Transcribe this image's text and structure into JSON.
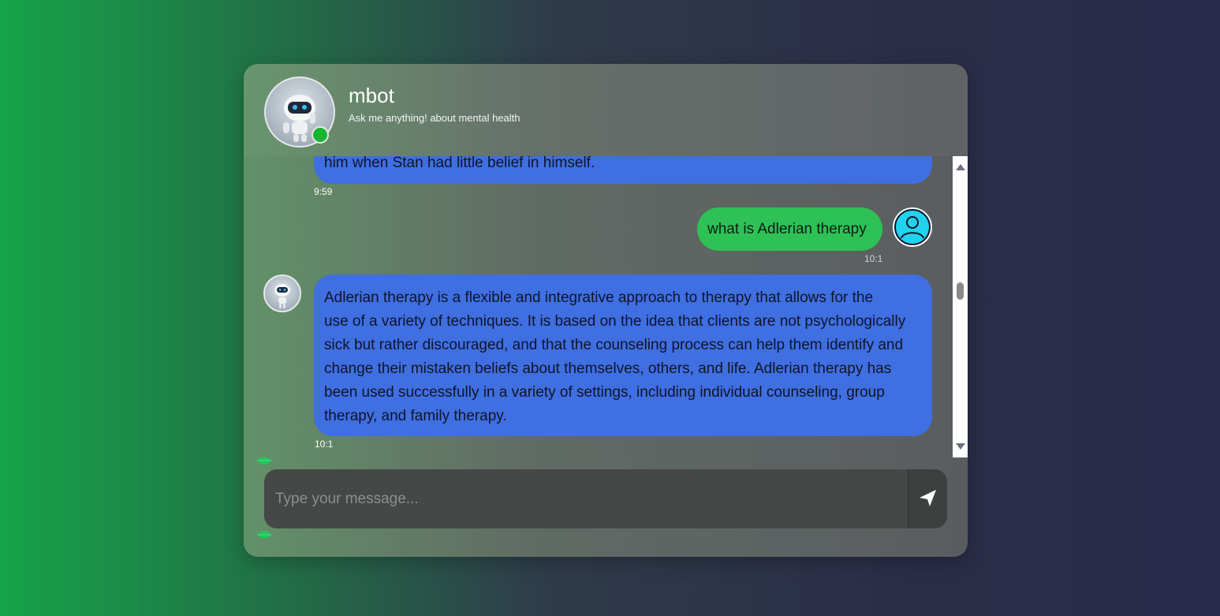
{
  "header": {
    "bot_name": "mbot",
    "subtitle": "Ask me anything! about mental health",
    "status": "online",
    "status_color": "#18b531"
  },
  "messages": [
    {
      "sender": "bot",
      "text": "him when Stan had little belief in himself.",
      "time": "9:59",
      "partially_visible": true
    },
    {
      "sender": "user",
      "text": "what is Adlerian therapy",
      "time": "10:1"
    },
    {
      "sender": "bot",
      "lines": [
        "Adlerian therapy is a flexible and integrative approach to therapy that allows for the",
        "use of a variety of techniques. It is based on the idea that clients are not psychologically",
        "sick but rather discouraged, and that the counseling process can help them identify and",
        "change their mistaken beliefs about themselves, others, and life. Adlerian therapy has",
        "been used successfully in a variety of settings, including individual counseling, group",
        "therapy, and family therapy."
      ],
      "time": "10:1"
    }
  ],
  "composer": {
    "placeholder": "Type your message...",
    "value": "",
    "send_icon": "send-arrow-icon"
  },
  "colors": {
    "bot_bubble": "#3f6fe0",
    "user_bubble": "#2ec156",
    "accent_green": "#16a34a",
    "background_dark": "#2a2a4a"
  },
  "icons": {
    "bot_avatar": "robot-avatar-icon",
    "user_avatar": "user-avatar-icon",
    "decor": "leaf-icon"
  }
}
